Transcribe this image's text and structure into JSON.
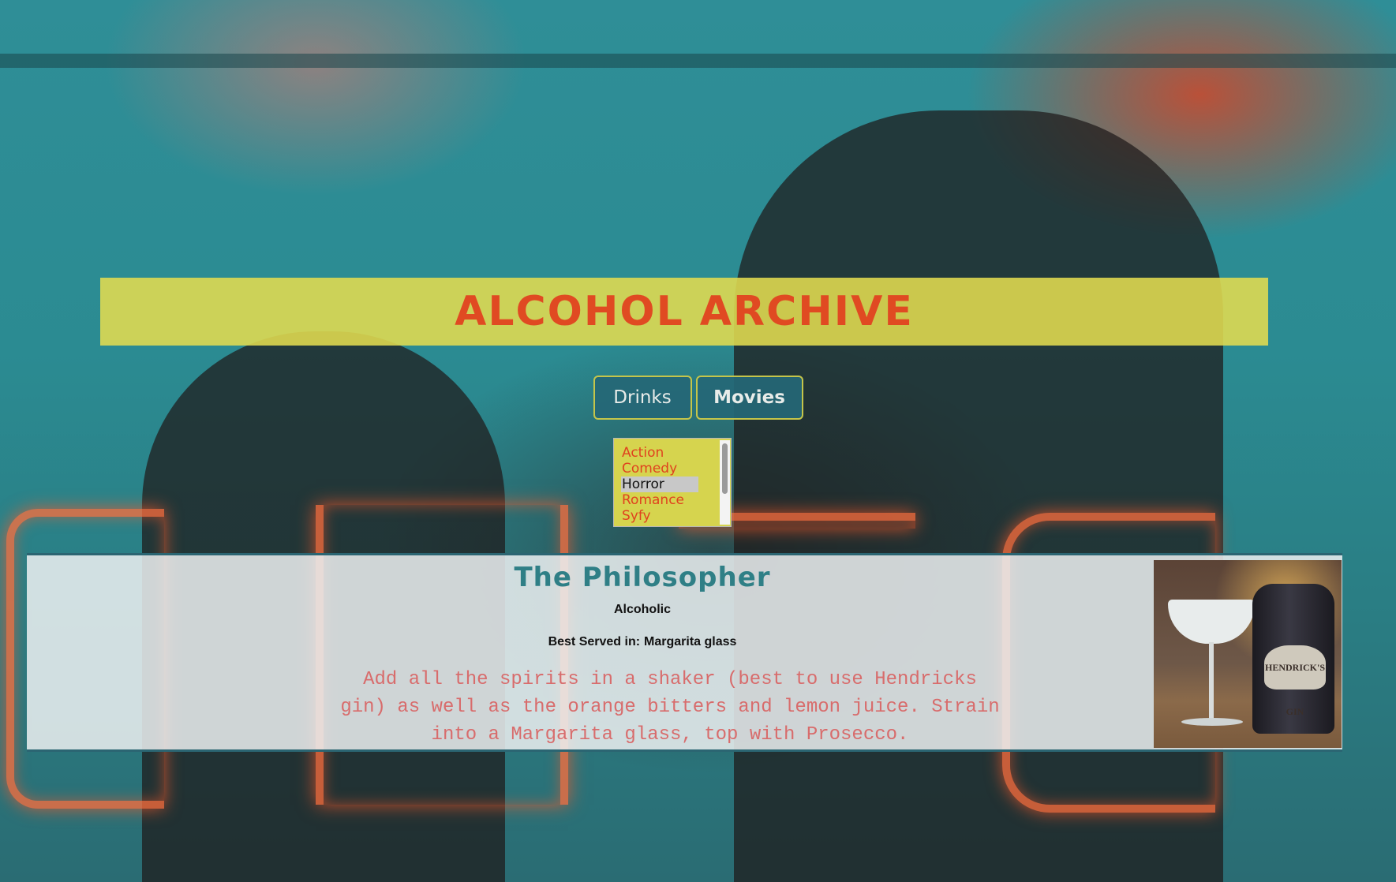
{
  "header": {
    "title": "ALCOHOL ARCHIVE"
  },
  "nav": {
    "drinks_label": "Drinks",
    "movies_label": "Movies"
  },
  "genres": {
    "items": [
      "Action",
      "Comedy",
      "Horror",
      "Romance",
      "Syfy"
    ],
    "selected": "Horror"
  },
  "drink": {
    "name": "The Philosopher",
    "type": "Alcoholic",
    "glass_prefix": "Best Served in:",
    "glass": "Margarita glass",
    "instructions": "Add all the spirits in a shaker (best to use Hendricks gin) as well as the orange bitters and lemon juice. Strain into a Margarita glass, top with Prosecco.",
    "image_label": "HENDRICK'S GIN"
  },
  "colors": {
    "accent_red": "#e04a22",
    "header_yellow": "#e2dc50",
    "teal": "#2f7f86",
    "button_bg": "#256776"
  }
}
